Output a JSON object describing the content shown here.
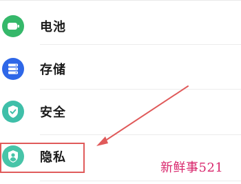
{
  "settings_list": {
    "items": [
      {
        "label": "电池",
        "icon": "battery-icon",
        "color": "#35b86a"
      },
      {
        "label": "存储",
        "icon": "storage-icon",
        "color": "#2e67e8"
      },
      {
        "label": "安全",
        "icon": "shield-check-icon",
        "color": "#3fbfa9"
      },
      {
        "label": "隐私",
        "icon": "privacy-shield-person-icon",
        "color": "#47c4a8"
      }
    ]
  },
  "annotation": {
    "highlight_color": "#e05a5a",
    "watermark": "新鲜事521"
  }
}
